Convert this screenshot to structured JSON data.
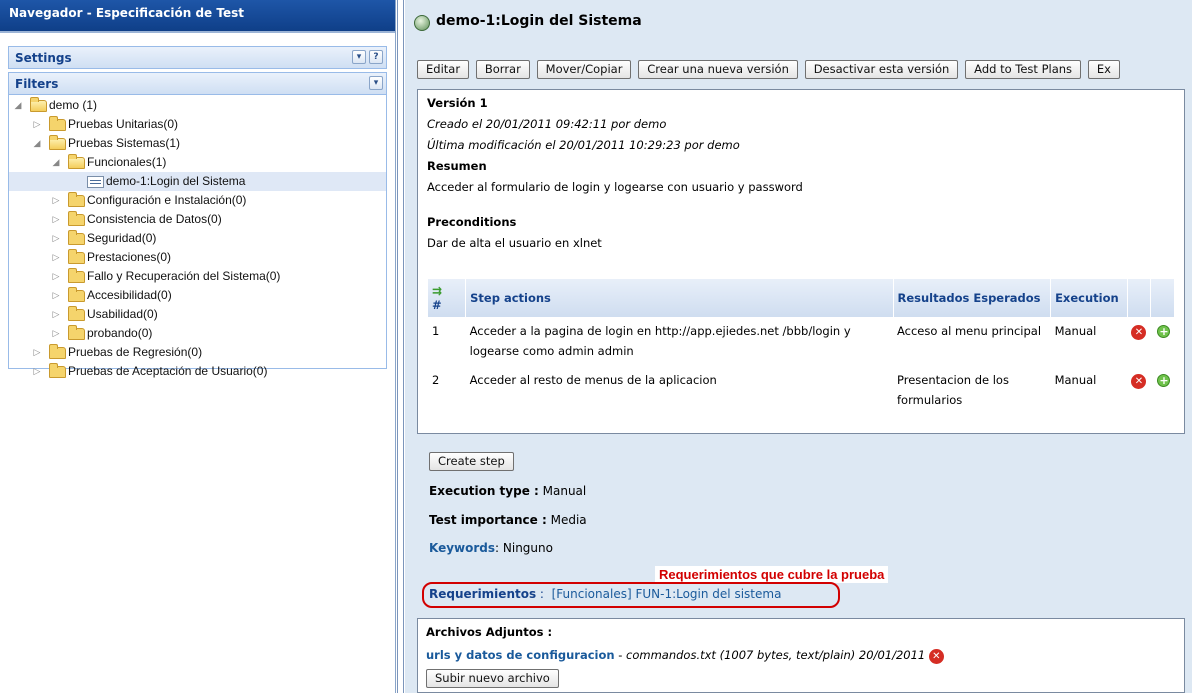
{
  "left": {
    "title": "Navegador - Especificación de Test",
    "settings_label": "Settings",
    "filters_label": "Filters",
    "tree": [
      {
        "label": "demo (1)",
        "level": 0,
        "expanded": true,
        "type": "folder"
      },
      {
        "label": "Pruebas Unitarias(0)",
        "level": 1,
        "expanded": false,
        "type": "folder"
      },
      {
        "label": "Pruebas Sistemas(1)",
        "level": 1,
        "expanded": true,
        "type": "folder"
      },
      {
        "label": "Funcionales(1)",
        "level": 2,
        "expanded": true,
        "type": "folder"
      },
      {
        "label": "demo-1:Login del Sistema",
        "level": 3,
        "type": "testcase",
        "selected": true
      },
      {
        "label": "Configuración e Instalación(0)",
        "level": 2,
        "expanded": false,
        "type": "folder"
      },
      {
        "label": "Consistencia de Datos(0)",
        "level": 2,
        "expanded": false,
        "type": "folder"
      },
      {
        "label": "Seguridad(0)",
        "level": 2,
        "expanded": false,
        "type": "folder"
      },
      {
        "label": "Prestaciones(0)",
        "level": 2,
        "expanded": false,
        "type": "folder"
      },
      {
        "label": "Fallo y Recuperación del Sistema(0)",
        "level": 2,
        "expanded": false,
        "type": "folder"
      },
      {
        "label": "Accesibilidad(0)",
        "level": 2,
        "expanded": false,
        "type": "folder"
      },
      {
        "label": "Usabilidad(0)",
        "level": 2,
        "expanded": false,
        "type": "folder"
      },
      {
        "label": "probando(0)",
        "level": 2,
        "expanded": false,
        "type": "folder"
      },
      {
        "label": "Pruebas de Regresión(0)",
        "level": 1,
        "expanded": false,
        "type": "folder"
      },
      {
        "label": "Pruebas de Aceptación de Usuario(0)",
        "level": 1,
        "expanded": false,
        "type": "folder"
      }
    ]
  },
  "testcase": {
    "title": "demo-1:Login del Sistema",
    "toolbar": {
      "edit": "Editar",
      "delete": "Borrar",
      "move_copy": "Mover/Copiar",
      "new_version": "Crear una nueva versión",
      "deactivate": "Desactivar esta versión",
      "add_to_plans": "Add to Test Plans",
      "export": "Ex"
    },
    "version": "Versión 1",
    "created": "Creado el 20/01/2011 09:42:11  por demo",
    "modified": "Última modificación el  20/01/2011 10:29:23  por demo",
    "summary_label": "Resumen",
    "summary": "Acceder al formulario de login y logearse con usuario y password",
    "preconditions_label": "Preconditions",
    "preconditions": "Dar de alta el usuario en xlnet",
    "steps_headers": {
      "num": "#",
      "actions": "Step actions",
      "expected": "Resultados Esperados",
      "execution": "Execution"
    },
    "steps": [
      {
        "num": "1",
        "action": "Acceder a la pagina de login en http://app.ejiedes.net /bbb/login y logearse como admin admin",
        "expected": "Acceso al menu principal",
        "execution": "Manual"
      },
      {
        "num": "2",
        "action": "Acceder al resto de menus de la aplicacion",
        "expected": "Presentacion de los formularios",
        "execution": "Manual"
      }
    ],
    "create_step": "Create step",
    "execution_type_label": "Execution type :",
    "execution_type": "Manual",
    "importance_label": "Test importance :",
    "importance": "Media",
    "keywords_label": "Keywords",
    "keywords": "Ninguno",
    "annotation": "Requerimientos que cubre la prueba",
    "requirements_label": "Requerimientos",
    "requirements": "[Funcionales] FUN-1:Login del sistema",
    "attachments_label": "Archivos Adjuntos :",
    "attachment_name": "urls y datos de configuracion",
    "attachment_info": "commandos.txt (1007 bytes, text/plain) 20/01/2011",
    "upload_button": "Subir nuevo archivo"
  },
  "colors": {
    "header_blue": "#1e56a8",
    "panel_bg": "#dde8f3",
    "accent_text": "#15428b",
    "annotation_red": "#d20000"
  }
}
